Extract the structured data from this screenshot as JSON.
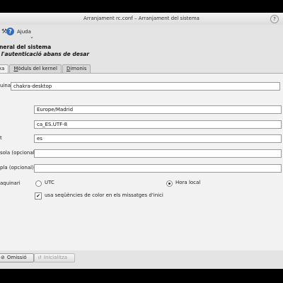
{
  "window": {
    "title": "Arranjament rc.conf – Arranjament del sistema",
    "help_button": "?"
  },
  "toolbar": {
    "tool_icon": "⚒",
    "help_label": "Ajuda",
    "menu_chevron": "⌄"
  },
  "header": {
    "title": "eneral del sistema",
    "subtitle": "à l'autenticació abans de desar"
  },
  "tabs": [
    {
      "pre": "",
      "key": "",
      "post": "xa"
    },
    {
      "pre": "",
      "key": "M",
      "post": "òduls del kernel"
    },
    {
      "pre": "",
      "key": "D",
      "post": "imonis"
    }
  ],
  "fields": {
    "hostname": {
      "label": "uina",
      "value": "chakra-desktop"
    },
    "timezone": {
      "value": "Europe/Madrid"
    },
    "locale": {
      "value": "ca_ES.UTF-8"
    },
    "keymap": {
      "label": "t",
      "value": "es"
    },
    "consolefont": {
      "label": "sola (opcional)",
      "value": ""
    },
    "consolemap": {
      "label": "pla (opcional)",
      "value": ""
    },
    "hwclock": {
      "label": "aquinari",
      "utc_label": "UTC",
      "local_label": "Hora local"
    },
    "color": {
      "label": "usa seqüències de color en els missatges d'inici"
    }
  },
  "buttons": {
    "cancel": "Omissió",
    "apply": "Inicialitza"
  }
}
